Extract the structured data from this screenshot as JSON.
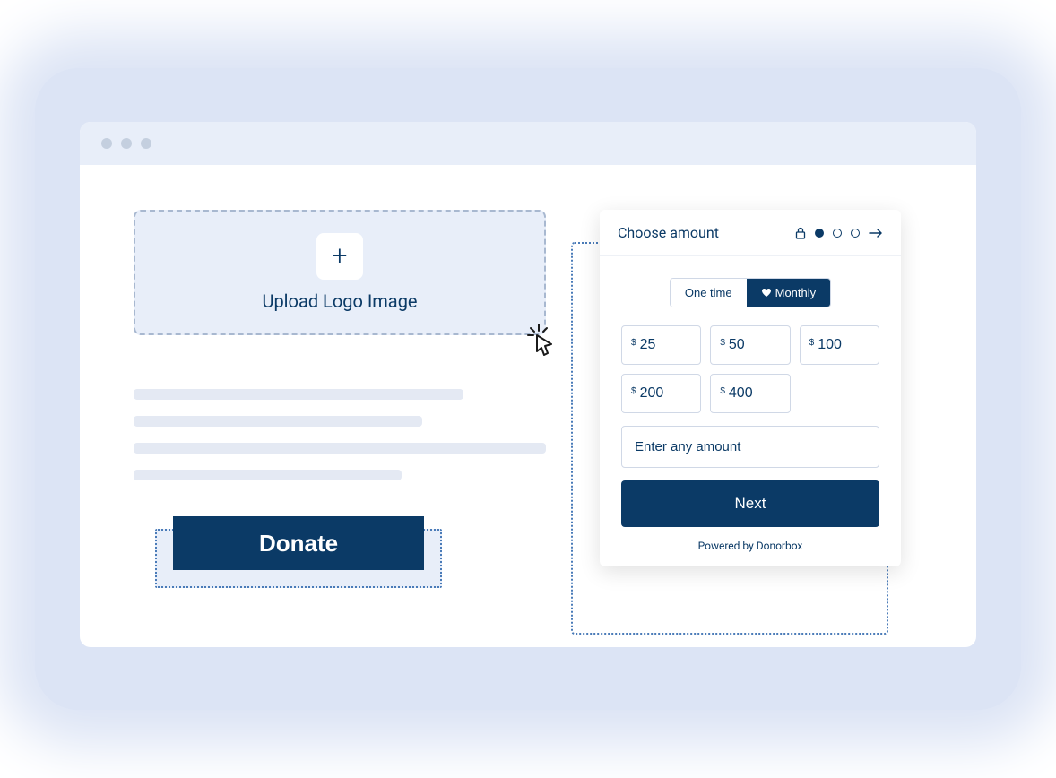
{
  "upload": {
    "label": "Upload Logo Image"
  },
  "donate_button": {
    "label": "Donate"
  },
  "widget": {
    "title": "Choose amount",
    "frequency": {
      "one_time": "One time",
      "monthly": "Monthly"
    },
    "currency_symbol": "$",
    "amounts": [
      "25",
      "50",
      "100",
      "200",
      "400"
    ],
    "custom_placeholder": "Enter any amount",
    "next_label": "Next",
    "powered_by": "Powered by Donorbox"
  }
}
